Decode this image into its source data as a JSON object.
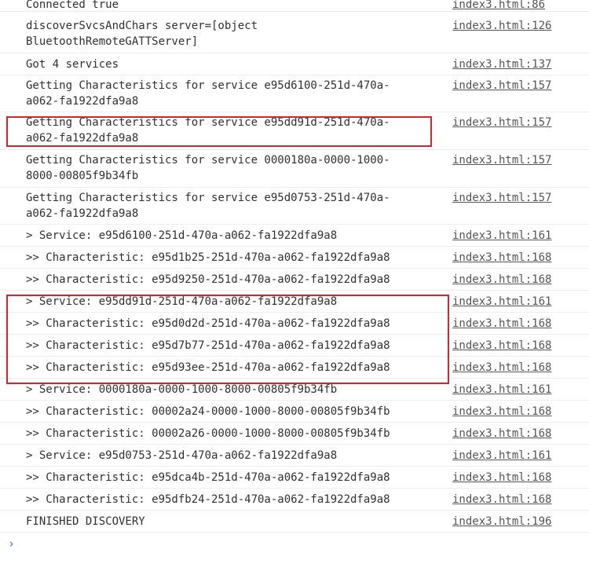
{
  "console": {
    "messages": [
      {
        "text": "Connected true",
        "source": "index3.html:86"
      },
      {
        "text": "discoverSvcsAndChars server=[object\nBluetoothRemoteGATTServer]",
        "source": "index3.html:126"
      },
      {
        "text": "Got 4 services",
        "source": "index3.html:137"
      },
      {
        "text": "Getting Characteristics for service e95d6100-251d-470a-\na062-fa1922dfa9a8",
        "source": "index3.html:157"
      },
      {
        "text": "Getting Characteristics for service e95dd91d-251d-470a-\na062-fa1922dfa9a8",
        "source": "index3.html:157"
      },
      {
        "text": "Getting Characteristics for service 0000180a-0000-1000-\n8000-00805f9b34fb",
        "source": "index3.html:157"
      },
      {
        "text": "Getting Characteristics for service e95d0753-251d-470a-\na062-fa1922dfa9a8",
        "source": "index3.html:157"
      },
      {
        "text": "> Service: e95d6100-251d-470a-a062-fa1922dfa9a8",
        "source": "index3.html:161"
      },
      {
        "text": ">> Characteristic: e95d1b25-251d-470a-a062-fa1922dfa9a8",
        "source": "index3.html:168"
      },
      {
        "text": ">> Characteristic: e95d9250-251d-470a-a062-fa1922dfa9a8",
        "source": "index3.html:168"
      },
      {
        "text": "> Service: e95dd91d-251d-470a-a062-fa1922dfa9a8",
        "source": "index3.html:161"
      },
      {
        "text": ">> Characteristic: e95d0d2d-251d-470a-a062-fa1922dfa9a8",
        "source": "index3.html:168"
      },
      {
        "text": ">> Characteristic: e95d7b77-251d-470a-a062-fa1922dfa9a8",
        "source": "index3.html:168"
      },
      {
        "text": ">> Characteristic: e95d93ee-251d-470a-a062-fa1922dfa9a8",
        "source": "index3.html:168"
      },
      {
        "text": "> Service: 0000180a-0000-1000-8000-00805f9b34fb",
        "source": "index3.html:161"
      },
      {
        "text": ">> Characteristic: 00002a24-0000-1000-8000-00805f9b34fb",
        "source": "index3.html:168"
      },
      {
        "text": ">> Characteristic: 00002a26-0000-1000-8000-00805f9b34fb",
        "source": "index3.html:168"
      },
      {
        "text": "> Service: e95d0753-251d-470a-a062-fa1922dfa9a8",
        "source": "index3.html:161"
      },
      {
        "text": ">> Characteristic: e95dca4b-251d-470a-a062-fa1922dfa9a8",
        "source": "index3.html:168"
      },
      {
        "text": ">> Characteristic: e95dfb24-251d-470a-a062-fa1922dfa9a8",
        "source": "index3.html:168"
      },
      {
        "text": "FINISHED DISCOVERY",
        "source": "index3.html:196"
      }
    ],
    "prompt_symbol": "›",
    "highlight_color": "#e0202e",
    "link_color": "#555555",
    "prompt_color": "#2a7ae2"
  }
}
